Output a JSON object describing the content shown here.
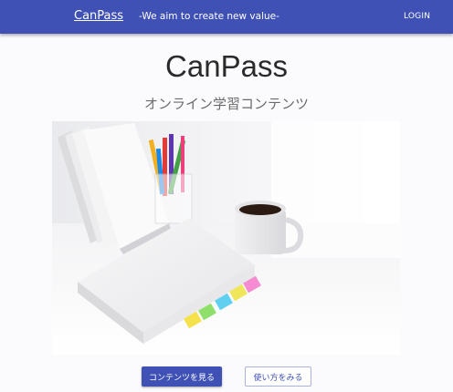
{
  "header": {
    "brand": "CanPass",
    "tagline": "-We aim to create new value-",
    "login_label": "LOGIN"
  },
  "hero": {
    "title": "CanPass",
    "subtitle": "オンライン学習コンテンツ"
  },
  "actions": {
    "view_contents_label": "コンテンツを見る",
    "how_to_use_label": "使い方をみる"
  },
  "colors": {
    "primary": "#3f51b5",
    "background": "#fbfbfd"
  }
}
